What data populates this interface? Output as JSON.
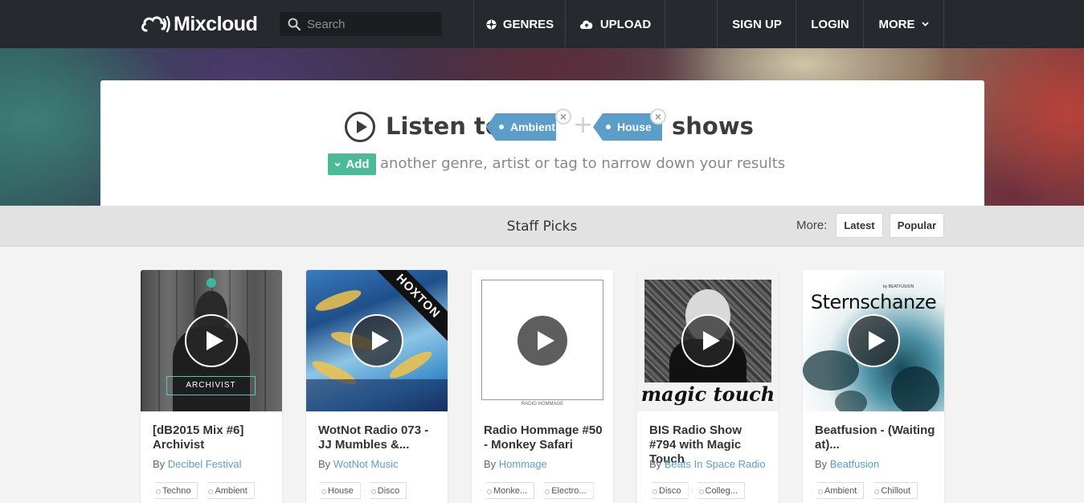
{
  "nav": {
    "logo": "Mixcloud",
    "search_placeholder": "Search",
    "items": [
      {
        "label": "GENRES",
        "icon": "genres-icon"
      },
      {
        "label": "UPLOAD",
        "icon": "upload-cloud-icon"
      },
      {
        "label": "SIGN UP"
      },
      {
        "label": "LOGIN"
      },
      {
        "label": "MORE",
        "icon": "chevron-down-icon"
      }
    ]
  },
  "hero": {
    "listen_to": "Listen to",
    "tags": [
      "Ambient",
      "House"
    ],
    "plus": "+",
    "shows": "shows",
    "add_label": "Add",
    "narrow_text": "another genre, artist or tag to narrow down your results"
  },
  "picks": {
    "title": "Staff Picks",
    "more_label": "More:",
    "sort_options": [
      "Latest",
      "Popular"
    ]
  },
  "cards": [
    {
      "title": "[dB2015 Mix #6] Archivist",
      "by": "By",
      "author": "Decibel Festival",
      "tags": [
        "Techno",
        "Ambient"
      ],
      "art_text": "ARCHIVIST"
    },
    {
      "title": "WotNot Radio 073 - JJ Mumbles &...",
      "by": "By",
      "author": "WotNot Music",
      "tags": [
        "House",
        "Disco"
      ],
      "art_text": "HOXTON"
    },
    {
      "title": "Radio Hommage #50 - Monkey Safari",
      "by": "By",
      "author": "Hommage",
      "tags": [
        "Monke...",
        "Electro..."
      ],
      "art_text": "RADIO HOMMAGE"
    },
    {
      "title": "BIS Radio Show #794 with Magic Touch",
      "by": "By",
      "author": "Beats In Space Radio",
      "tags": [
        "Disco",
        "Colleg..."
      ],
      "art_text": "magic touch"
    },
    {
      "title": "Beatfusion - (Waiting at)...",
      "by": "By",
      "author": "Beatfusion",
      "tags": [
        "Ambient",
        "Chillout"
      ],
      "art_text": "Sternschanze",
      "art_subtext": "by BEATFUSION"
    }
  ],
  "colors": {
    "nav_bg": "#262a2e",
    "tag_blue": "#5b9ec9",
    "add_green": "#4cba96",
    "link_blue": "#5b9ec9"
  }
}
